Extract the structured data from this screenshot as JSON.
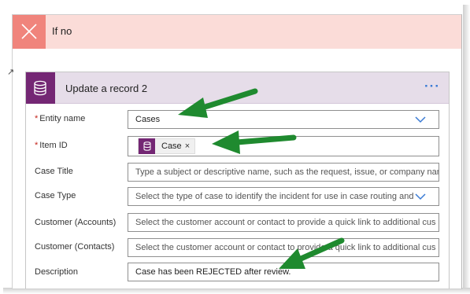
{
  "if_no": {
    "title": "If no"
  },
  "left_glyph": "↗",
  "card": {
    "title": "Update a record 2",
    "more": "···"
  },
  "fields": {
    "entity_name": {
      "label": "Entity name",
      "required": "*",
      "value": "Cases"
    },
    "item_id": {
      "label": "Item ID",
      "required": "*",
      "token": "Case",
      "token_remove": "×"
    },
    "case_title": {
      "label": "Case Title",
      "placeholder": "Type a subject or descriptive name, such as the request, issue, or company nam"
    },
    "case_type": {
      "label": "Case Type",
      "placeholder": "Select the type of case to identify the incident for use in case routing and"
    },
    "customer_accounts": {
      "label": "Customer (Accounts)",
      "placeholder": "Select the customer account or contact to provide a quick link to additional cus"
    },
    "customer_contacts": {
      "label": "Customer (Contacts)",
      "placeholder": "Select the customer account or contact to provide a quick link to additional cus"
    },
    "description": {
      "label": "Description",
      "value": "Case has been REJECTED after review."
    }
  },
  "colors": {
    "if_no_header": "#fbdcd8",
    "if_no_icon": "#f0847c",
    "card_header": "#e6dde9",
    "dataverse_purple": "#742774",
    "annotation_arrow": "#1f8a2f",
    "link_blue": "#3a7bd5"
  },
  "icons": {
    "if_no": "close-x-icon",
    "card": "database-icon",
    "dropdown": "chevron-down-icon",
    "token": "database-icon"
  }
}
